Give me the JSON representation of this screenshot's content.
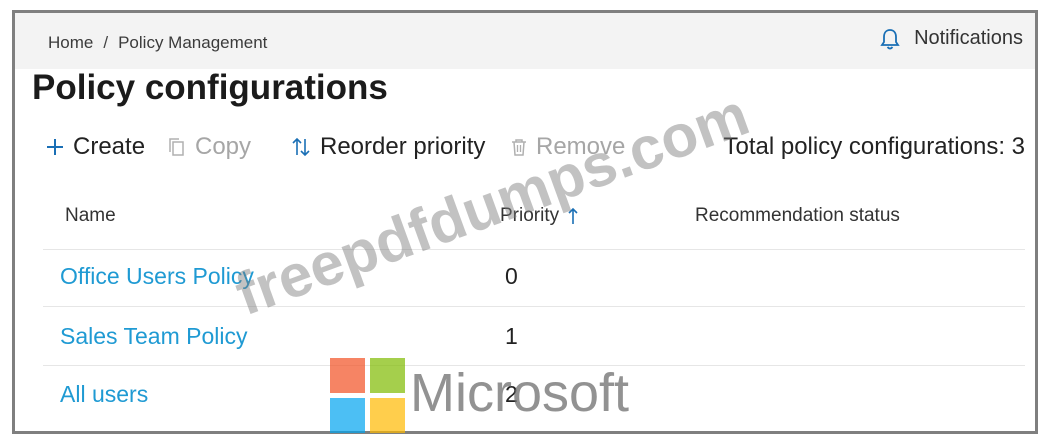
{
  "breadcrumb": {
    "home": "Home",
    "separator": "/",
    "current": "Policy Management"
  },
  "notifications": {
    "label": "Notifications",
    "icon": "bell-icon"
  },
  "page": {
    "title": "Policy configurations"
  },
  "toolbar": {
    "create": {
      "label": "Create",
      "icon": "plus-icon",
      "enabled": true
    },
    "copy": {
      "label": "Copy",
      "icon": "copy-icon",
      "enabled": false
    },
    "reorder": {
      "label": "Reorder priority",
      "icon": "sort-arrows-icon",
      "enabled": true
    },
    "remove": {
      "label": "Remove",
      "icon": "trash-icon",
      "enabled": false
    },
    "total": "Total policy configurations: 3"
  },
  "table": {
    "columns": {
      "name": "Name",
      "priority": "Priority",
      "recommendation": "Recommendation status"
    },
    "sorted_by": "Priority",
    "rows": [
      {
        "name": "Office Users Policy",
        "priority": "0",
        "recommendation": ""
      },
      {
        "name": "Sales Team Policy",
        "priority": "1",
        "recommendation": ""
      },
      {
        "name": "All users",
        "priority": "2",
        "recommendation": ""
      }
    ]
  },
  "watermark": {
    "text": "freepdfdumps.com",
    "brand": "Microsoft"
  },
  "colors": {
    "link": "#1f9ad3",
    "topbar": "#f3f3f3",
    "disabled": "#a6a6a6",
    "accent": "#0078d4"
  }
}
